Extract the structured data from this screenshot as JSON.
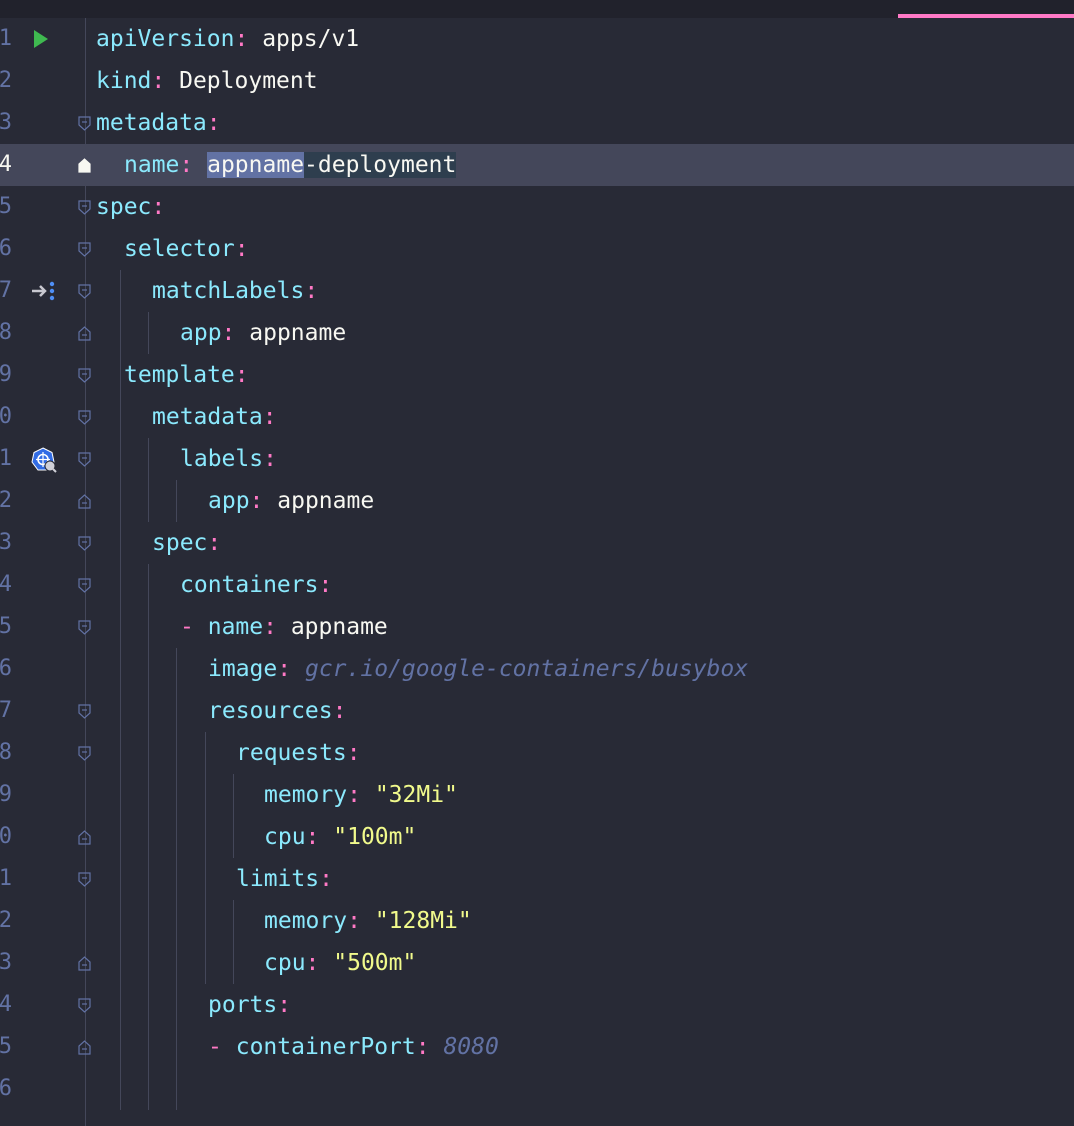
{
  "editor": {
    "current_line": 4,
    "lines": [
      {
        "n": "1",
        "text": ""
      },
      {
        "n": "2",
        "text": ""
      },
      {
        "n": "3",
        "text": ""
      },
      {
        "n": "4",
        "text": ""
      },
      {
        "n": "5",
        "text": ""
      },
      {
        "n": "6",
        "text": ""
      },
      {
        "n": "7",
        "text": ""
      },
      {
        "n": "8",
        "text": ""
      },
      {
        "n": "9",
        "text": ""
      },
      {
        "n": "0",
        "text": ""
      },
      {
        "n": "1",
        "text": ""
      },
      {
        "n": "2",
        "text": ""
      },
      {
        "n": "3",
        "text": ""
      },
      {
        "n": "4",
        "text": ""
      },
      {
        "n": "5",
        "text": ""
      },
      {
        "n": "6",
        "text": ""
      },
      {
        "n": "7",
        "text": ""
      },
      {
        "n": "8",
        "text": ""
      },
      {
        "n": "9",
        "text": ""
      },
      {
        "n": "0",
        "text": ""
      },
      {
        "n": "1",
        "text": ""
      },
      {
        "n": "2",
        "text": ""
      },
      {
        "n": "3",
        "text": ""
      },
      {
        "n": "4",
        "text": ""
      },
      {
        "n": "5",
        "text": ""
      },
      {
        "n": "6",
        "text": ""
      }
    ],
    "tokens": {
      "l1_key": "apiVersion",
      "l1_val": "apps/v1",
      "l2_key": "kind",
      "l2_val": "Deployment",
      "l3_key": "metadata",
      "l4_key": "name",
      "l4_val_a": "appname",
      "l4_val_b": "-deployment",
      "l5_key": "spec",
      "l6_key": "selector",
      "l7_key": "matchLabels",
      "l8_key": "app",
      "l8_val": "appname",
      "l9_key": "template",
      "l10_key": "metadata",
      "l11_key": "labels",
      "l12_key": "app",
      "l12_val": "appname",
      "l13_key": "spec",
      "l14_key": "containers",
      "l15_dash": "-",
      "l15_key": "name",
      "l15_val": "appname",
      "l16_key": "image",
      "l16_val": "gcr.io/google-containers/busybox",
      "l17_key": "resources",
      "l18_key": "requests",
      "l19_key": "memory",
      "l19_val": "\"32Mi\"",
      "l20_key": "cpu",
      "l20_val": "\"100m\"",
      "l21_key": "limits",
      "l22_key": "memory",
      "l22_val": "\"128Mi\"",
      "l23_key": "cpu",
      "l23_val": "\"500m\"",
      "l24_key": "ports",
      "l25_dash": "-",
      "l25_key": "containerPort",
      "l25_val": "8080",
      "colon": ":"
    }
  },
  "icons": {
    "run": "run-gutter-icon",
    "implemented": "implemented-gutter-icon",
    "kubernetes": "kubernetes-gutter-icon"
  },
  "colors": {
    "background": "#282a36",
    "current_line": "#44475a",
    "key": "#8be9fd",
    "colon": "#ff79c6",
    "string": "#f1fa8c",
    "comment_italic": "#6272a4",
    "tab_accent": "#ff79c6"
  }
}
